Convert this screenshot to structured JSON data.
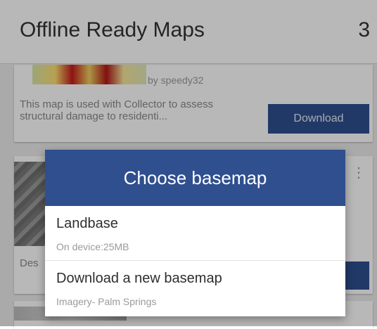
{
  "header": {
    "title": "Offline Ready Maps",
    "count": "3"
  },
  "cards": [
    {
      "owner": "by speedy32",
      "description": "This map is used with Collector to assess structural damage to residenti...",
      "download_label": "Download"
    },
    {
      "description_cut": "Des"
    }
  ],
  "dialog": {
    "title": "Choose basemap",
    "options": [
      {
        "title": "Landbase",
        "subtitle": "On device:25MB"
      },
      {
        "title": "Download a new basemap",
        "subtitle": "Imagery- Palm Springs"
      }
    ]
  },
  "colors": {
    "accent": "#2f4f8f",
    "scrim": "rgba(0,0,0,0.28)"
  }
}
